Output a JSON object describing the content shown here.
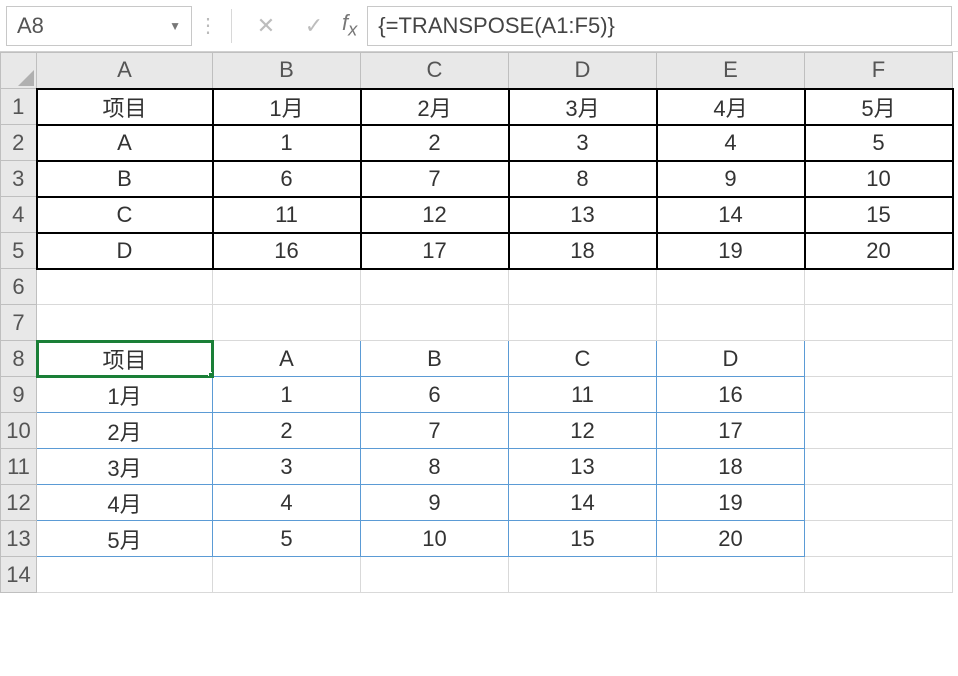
{
  "nameBox": "A8",
  "formula": "{=TRANSPOSE(A1:F5)}",
  "colHeaders": [
    "A",
    "B",
    "C",
    "D",
    "E",
    "F"
  ],
  "rowHeaders": [
    "1",
    "2",
    "3",
    "4",
    "5",
    "6",
    "7",
    "8",
    "9",
    "10",
    "11",
    "12",
    "13",
    "14"
  ],
  "cells": {
    "r1": {
      "A": "项目",
      "B": "1月",
      "C": "2月",
      "D": "3月",
      "E": "4月",
      "F": "5月"
    },
    "r2": {
      "A": "A",
      "B": "1",
      "C": "2",
      "D": "3",
      "E": "4",
      "F": "5"
    },
    "r3": {
      "A": "B",
      "B": "6",
      "C": "7",
      "D": "8",
      "E": "9",
      "F": "10"
    },
    "r4": {
      "A": "C",
      "B": "11",
      "C": "12",
      "D": "13",
      "E": "14",
      "F": "15"
    },
    "r5": {
      "A": "D",
      "B": "16",
      "C": "17",
      "D": "18",
      "E": "19",
      "F": "20"
    },
    "r6": {
      "A": "",
      "B": "",
      "C": "",
      "D": "",
      "E": "",
      "F": ""
    },
    "r7": {
      "A": "",
      "B": "",
      "C": "",
      "D": "",
      "E": "",
      "F": ""
    },
    "r8": {
      "A": "项目",
      "B": "A",
      "C": "B",
      "D": "C",
      "E": "D",
      "F": ""
    },
    "r9": {
      "A": "1月",
      "B": "1",
      "C": "6",
      "D": "11",
      "E": "16",
      "F": ""
    },
    "r10": {
      "A": "2月",
      "B": "2",
      "C": "7",
      "D": "12",
      "E": "17",
      "F": ""
    },
    "r11": {
      "A": "3月",
      "B": "3",
      "C": "8",
      "D": "13",
      "E": "18",
      "F": ""
    },
    "r12": {
      "A": "4月",
      "B": "4",
      "C": "9",
      "D": "14",
      "E": "19",
      "F": ""
    },
    "r13": {
      "A": "5月",
      "B": "5",
      "C": "10",
      "D": "15",
      "E": "20",
      "F": ""
    },
    "r14": {
      "A": "",
      "B": "",
      "C": "",
      "D": "",
      "E": "",
      "F": ""
    }
  }
}
